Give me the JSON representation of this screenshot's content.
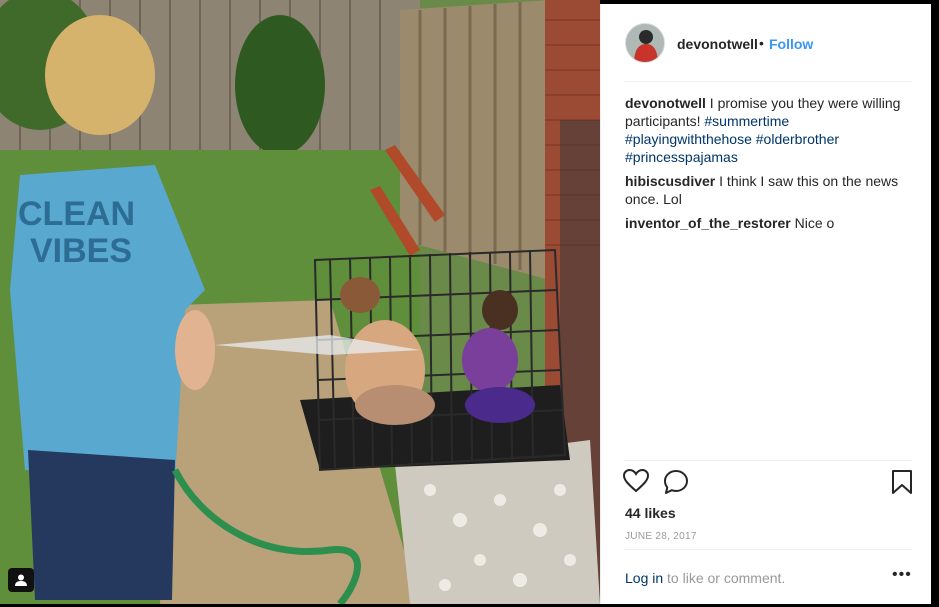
{
  "post": {
    "username": "devonotwell",
    "separator": "•",
    "follow_label": "Follow"
  },
  "caption": {
    "username": "devonotwell",
    "text": " I promise you they were willing participants! ",
    "tags": [
      "#summertime",
      "#playingwiththehose",
      "#olderbrother",
      "#princesspajamas"
    ]
  },
  "comments": [
    {
      "username": "hibiscusdiver",
      "text": " I think I saw this on the news once. Lol"
    },
    {
      "username": "inventor_of_the_restorer",
      "text": " Nice o"
    }
  ],
  "shirt_text": {
    "line1": "CLEAN",
    "line2": "VIBES"
  },
  "likes_label": "44 likes",
  "date_label": "JUNE 28, 2017",
  "login": {
    "link_label": "Log in",
    "rest_text": " to like or comment."
  },
  "more_label": "•••",
  "icons": {
    "like": "heart-icon",
    "comment": "comment-icon",
    "save": "bookmark-icon",
    "tag": "user-tag-icon"
  },
  "colors": {
    "accent": "#3897f0",
    "hashtag": "#003569",
    "text": "#262626",
    "muted": "#999999"
  }
}
